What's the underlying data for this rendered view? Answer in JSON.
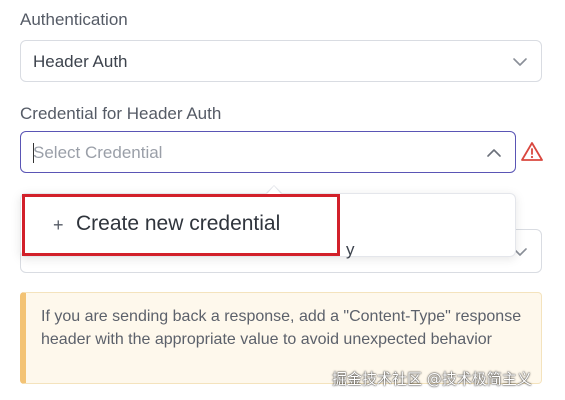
{
  "authentication": {
    "label": "Authentication",
    "selected": "Header Auth"
  },
  "credential": {
    "label": "Credential for Header Auth",
    "placeholder": "Select Credential",
    "status_icon": "warning-triangle-icon",
    "status_color": "#d9473f"
  },
  "dropdown": {
    "create_icon": "+",
    "create_label": "Create new credential",
    "highlight_color": "#d2202a"
  },
  "hidden_field": {
    "partial_text": "y"
  },
  "notice": {
    "text": "If you are sending back a response, add a \"Content-Type\" response header with the appropriate value to avoid unexpected behavior",
    "accent_color": "#f3c375"
  },
  "watermark": "掘金技术社区 @技术极简主义",
  "colors": {
    "focus_border": "#5a55b5",
    "notice_bg": "#fef8ec"
  }
}
